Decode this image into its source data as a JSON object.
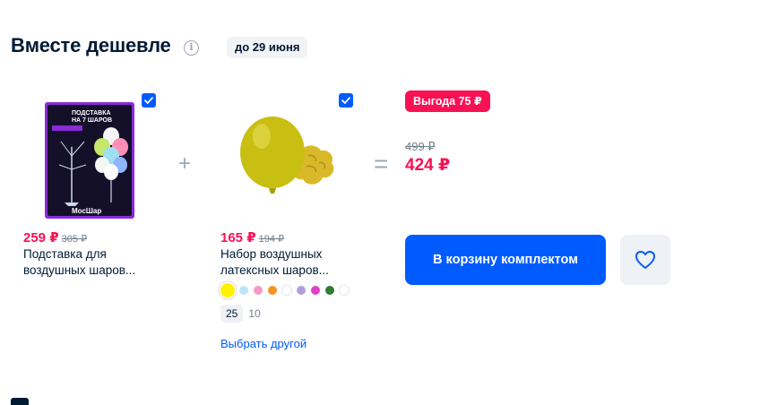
{
  "section": {
    "title": "Вместе дешевле",
    "date_chip": "до 29 июня"
  },
  "items": [
    {
      "image_alt": "Подставка на 7 шаров",
      "image_caption_top": "ПОДСТАВКА НА 7 ШАРОВ",
      "image_brand": "МосШар",
      "checked": true,
      "price": "259 ₽",
      "old_price": "305 ₽",
      "name_line1": "Подставка для",
      "name_line2": "воздушных шаров..."
    },
    {
      "image_alt": "Набор жёлтых латексных шаров",
      "checked": true,
      "price": "165 ₽",
      "old_price": "194 ₽",
      "name_line1": "Набор воздушных",
      "name_line2": "латексных шаров...",
      "swatches": [
        "#fff200",
        "#bfe3f7",
        "#f59ac3",
        "#f7941d",
        "#ffffff",
        "#b39ddb",
        "#e040c8",
        "#2e7d32",
        "#ffffff"
      ],
      "sizes": [
        {
          "label": "25",
          "active": true
        },
        {
          "label": "10",
          "active": false
        }
      ],
      "change_link": "Выбрать другой"
    }
  ],
  "operators": {
    "plus": "+",
    "equals": "="
  },
  "summary": {
    "profit_badge": "Выгода 75 ₽",
    "total_old": "499 ₽",
    "total_new": "424 ₽",
    "cart_button": "В корзину комплектом"
  },
  "colors": {
    "accent": "#005bff",
    "price": "#f91155",
    "text": "#001a34",
    "muted": "#707f8d"
  },
  "icons": {
    "info": "info-icon",
    "heart": "heart-icon",
    "check": "check-icon"
  }
}
